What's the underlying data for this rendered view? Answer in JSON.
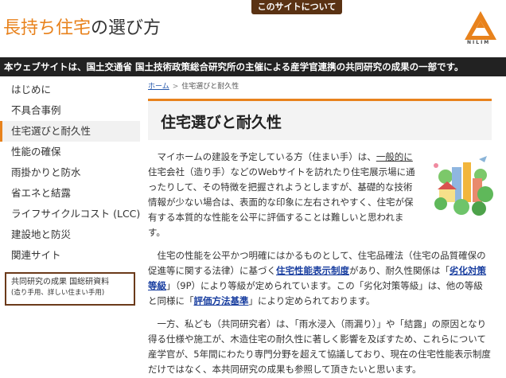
{
  "header": {
    "about_tab": "このサイトについて",
    "title_highlight": "長持ち住宅",
    "title_rest": "の選び方",
    "logo_text": "NILIM"
  },
  "notice": "本ウェブサイトは、国土交通省 国土技術政策総合研究所の主催による産学官連携の共同研究の成果の一部です。",
  "sidebar": {
    "items": [
      {
        "label": "はじめに"
      },
      {
        "label": "不具合事例"
      },
      {
        "label": "住宅選びと耐久性"
      },
      {
        "label": "性能の確保"
      },
      {
        "label": "雨掛かりと防水"
      },
      {
        "label": "省エネと結露"
      },
      {
        "label": "ライフサイクルコスト (LCC)"
      },
      {
        "label": "建設地と防災"
      },
      {
        "label": "関連サイト"
      }
    ],
    "active_index": 2,
    "research_box": {
      "link": "共同研究の成果 国総研資料",
      "sub": "(造り手用、詳しい住まい手用)"
    }
  },
  "breadcrumb": {
    "home": "ホーム",
    "separator": ">",
    "current": "住宅選びと耐久性"
  },
  "main": {
    "title": "住宅選びと耐久性",
    "p1": {
      "a": "マイホームの建設を予定している方（住まい手）は、",
      "b": "一般的に",
      "c": "住宅会社（造り手）などのWebサイトを訪れたり住宅展示場に通ったりして、その特徴を把握されようとしますが、基礎的な技術情報が少ない場合は、表面的な印象に左右されやすく、住宅が保有する本質的な性能を公平に評価することは難しいと思われます。"
    },
    "p2": {
      "a": "住宅の性能を公平かつ明確にはかるものとして、住宅品確法（住宅の品質確保の促進等に関する法律）に基づく",
      "link1": "住宅性能表示制度",
      "b": "があり、耐久性関係は「",
      "link2": "劣化対策等級",
      "c": "」（9P）により等級が定められています。この「劣化対策等級」は、他の等級と同様に「",
      "link3": "評価方法基準",
      "d": "」により定められております。"
    },
    "p3": "一方、私ども（共同研究者）は、「雨水浸入（雨漏り）」や「結露」の原因となり得る仕様や施工が、木造住宅の耐久性に著しく影響を及ぼすため、これらについて産学官が、5年間にわたり専門分野を超えて協議しており、現在の住宅性能表示制度だけではなく、本共同研究の成果も参照して頂きたいと思います。"
  },
  "colors": {
    "accent": "#e8821c",
    "brown": "#5a3213",
    "notice_bg": "#222222",
    "link": "#1a3fa0"
  }
}
